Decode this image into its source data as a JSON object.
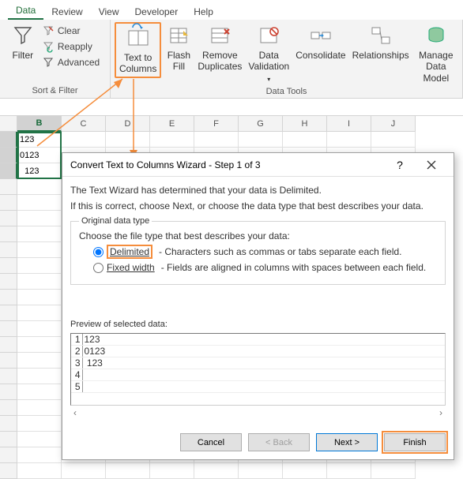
{
  "tabs": [
    "Data",
    "Review",
    "View",
    "Developer",
    "Help"
  ],
  "activeTab": 0,
  "ribbon": {
    "sortFilter": {
      "label": "Sort & Filter",
      "filter": "Filter",
      "clear": "Clear",
      "reapply": "Reapply",
      "advanced": "Advanced"
    },
    "dataTools": {
      "label": "Data Tools",
      "textToColumns": "Text to\nColumns",
      "flashFill": "Flash\nFill",
      "removeDuplicates": "Remove\nDuplicates",
      "dataValidation": "Data\nValidation",
      "consolidate": "Consolidate",
      "relationships": "Relationships",
      "manageDataModel": "Manage\nData Model"
    }
  },
  "grid": {
    "columns": [
      "B",
      "C",
      "D",
      "E",
      "F",
      "G",
      "H",
      "I",
      "J"
    ],
    "rows": [
      {
        "b": "123"
      },
      {
        "b": "0123"
      },
      {
        "b": "  123"
      }
    ]
  },
  "selection": {
    "col": "B",
    "rows": [
      1,
      2,
      3
    ]
  },
  "dialog": {
    "title": "Convert Text to Columns Wizard - Step 1 of 3",
    "help": "?",
    "intro1": "The Text Wizard has determined that your data is Delimited.",
    "intro2": "If this is correct, choose Next, or choose the data type that best describes your data.",
    "groupLabel": "Original data type",
    "choose": "Choose the file type that best describes your data:",
    "radios": [
      {
        "label": "Delimited",
        "desc": "- Characters such as commas or tabs separate each field.",
        "checked": true
      },
      {
        "label": "Fixed width",
        "desc": "- Fields are aligned in columns with spaces between each field.",
        "checked": false
      }
    ],
    "previewLabel": "Preview of selected data:",
    "previewRows": [
      "123",
      "0123",
      " 123",
      "",
      ""
    ],
    "buttons": {
      "cancel": "Cancel",
      "back": "< Back",
      "next": "Next >",
      "finish": "Finish"
    }
  }
}
